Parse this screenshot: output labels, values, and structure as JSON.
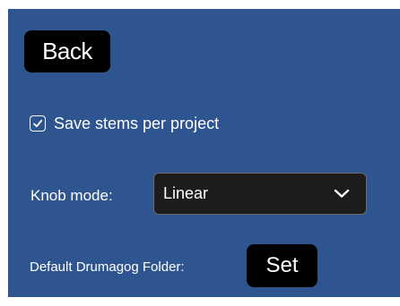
{
  "colors": {
    "panel_background": "#2f5590",
    "button_background": "#000000",
    "select_background": "#1c1c1c",
    "text": "#ffffff"
  },
  "back_button": {
    "label": "Back",
    "icon": null
  },
  "save_stems": {
    "label": "Save stems per project",
    "checked": true,
    "icon": "checkmark-icon"
  },
  "knob_mode": {
    "label": "Knob mode:",
    "selected": "Linear",
    "icon": "chevron-down-icon"
  },
  "default_folder": {
    "label": "Default Drumagog Folder:",
    "button_label": "Set"
  }
}
